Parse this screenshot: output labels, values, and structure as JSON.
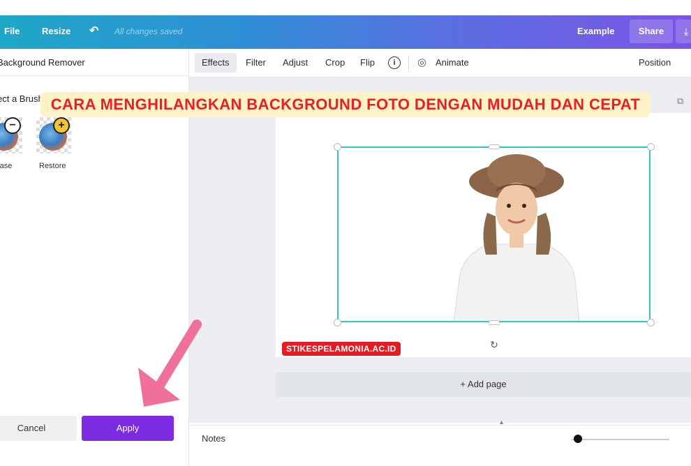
{
  "topbar": {
    "file": "File",
    "resize": "Resize",
    "undo_icon": "undo-icon",
    "saved_status": "All changes saved",
    "example": "Example",
    "share": "Share",
    "download_icon": "download-icon"
  },
  "left_panel": {
    "title": "Background Remover",
    "select_brush": "ect a Brush",
    "brushes": [
      {
        "label": "rase",
        "icon": "erase-brush-icon"
      },
      {
        "label": "Restore",
        "icon": "restore-brush-icon"
      }
    ],
    "cancel": "Cancel",
    "apply": "Apply"
  },
  "editor_toolbar": {
    "effects": "Effects",
    "filter": "Filter",
    "adjust": "Adjust",
    "crop": "Crop",
    "flip": "Flip",
    "animate": "Animate",
    "position": "Position"
  },
  "canvas": {
    "add_page": "+ Add page",
    "notes": "Notes"
  },
  "overlay": {
    "headline": "CARA MENGHILANGKAN BACKGROUND FOTO DENGAN MUDAH DAN CEPAT",
    "watermark": "STIKESPELAMONIA.AC.ID"
  },
  "colors": {
    "apply_button": "#7c2be0",
    "selection": "#2ec4c8",
    "headline_text": "#ea1f1f",
    "watermark_bg": "#e31b23",
    "arrow": "#f0709a"
  }
}
